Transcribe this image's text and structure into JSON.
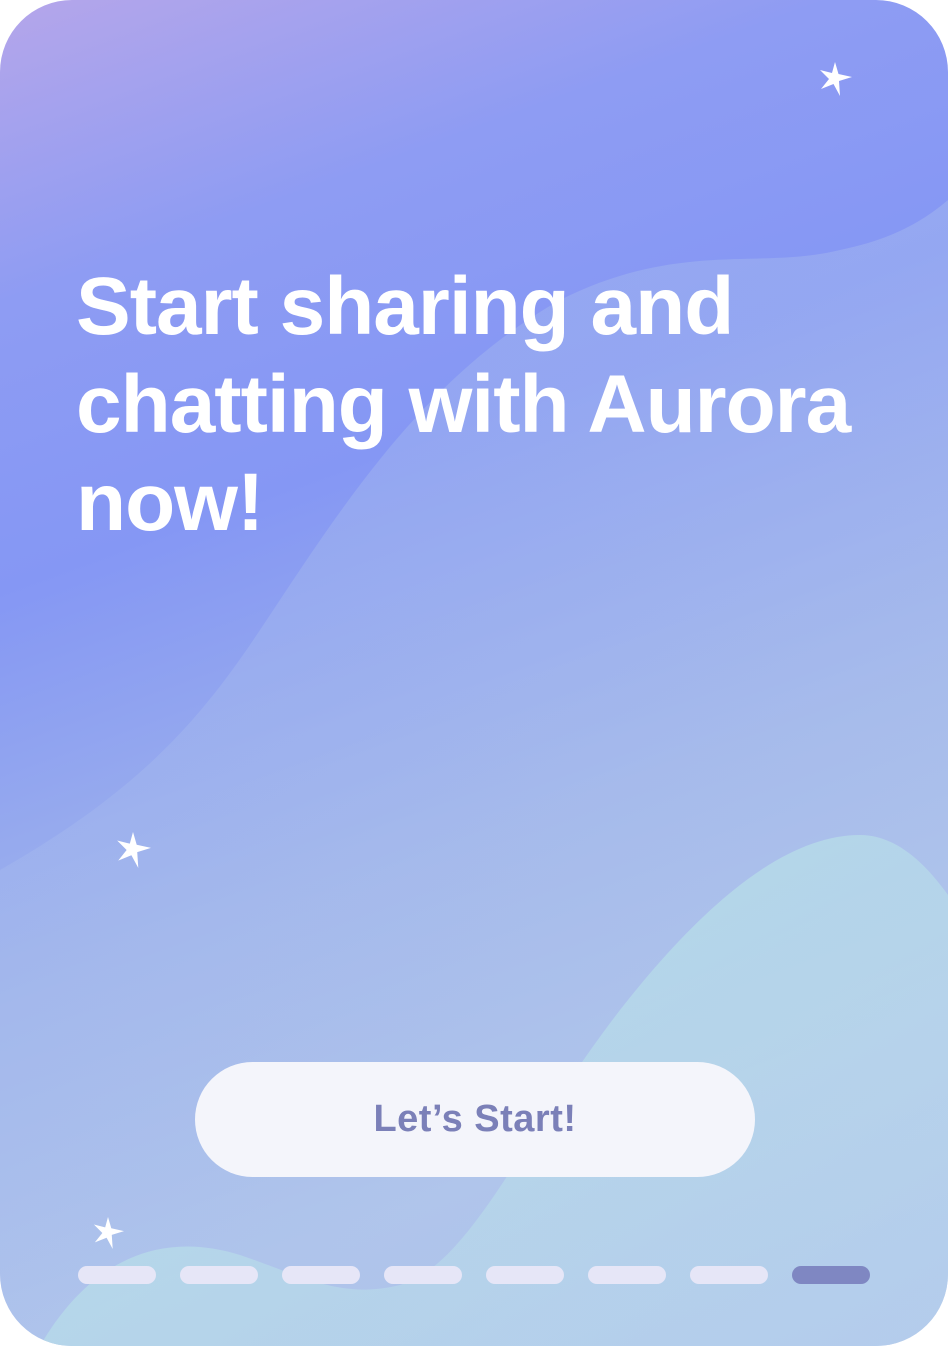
{
  "onboarding": {
    "headline": "Start sharing and chatting with Aurora now!",
    "start_button_label": "Let’s Start!",
    "page_indicator": {
      "total": 8,
      "current": 8
    }
  },
  "icons": [
    "sparkle-star-icon",
    "sparkle-star-icon",
    "sparkle-star-icon"
  ],
  "colors": {
    "background_top": "#b5a6ea",
    "background_mid": "#8597f4",
    "background_bottom": "#aabfe8",
    "hill": "#b8e2e6",
    "button_bg": "#f4f5fb",
    "button_text": "#7b80b8",
    "indicator_inactive": "#e6e6f7",
    "indicator_active": "#7f87c2"
  }
}
